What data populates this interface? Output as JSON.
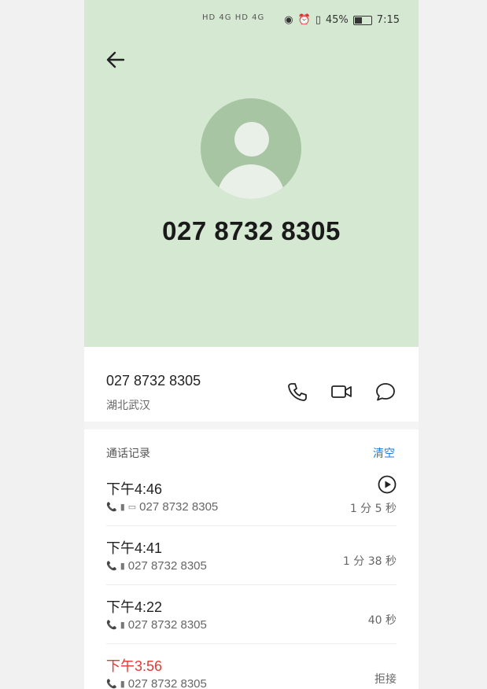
{
  "status_bar": {
    "left_indicators": "HD 4G HD 4G",
    "battery": "45%",
    "time": "7:15"
  },
  "header": {
    "back_icon": "arrow-left-icon",
    "phone_number": "027 8732 8305"
  },
  "contact": {
    "number": "027 8732 8305",
    "location": "湖北武汉"
  },
  "records": {
    "title": "通话记录",
    "clear_label": "清空",
    "items": [
      {
        "time": "下午4:46",
        "number": "027 8732 8305",
        "duration": "1 分 5 秒",
        "has_recording": true,
        "missed": false
      },
      {
        "time": "下午4:41",
        "number": "027 8732 8305",
        "duration": "1 分 38 秒",
        "has_recording": false,
        "missed": false
      },
      {
        "time": "下午4:22",
        "number": "027 8732 8305",
        "duration": "40 秒",
        "has_recording": false,
        "missed": false
      },
      {
        "time": "下午3:56",
        "number": "027 8732 8305",
        "duration": "拒接",
        "has_recording": false,
        "missed": true
      }
    ]
  },
  "colors": {
    "hero_bg": "#d5e8d2",
    "avatar_bg": "#a7c4a3",
    "accent": "#1e7fd8",
    "missed": "#e53935"
  }
}
